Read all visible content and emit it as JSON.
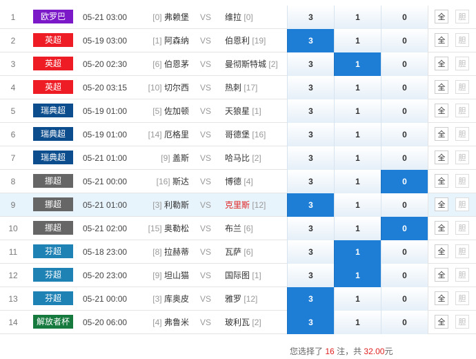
{
  "colors": {
    "selected_odds": "#1e7ed6",
    "highlight_row": "#e8f4fc",
    "red_text": "#e02020"
  },
  "rows": [
    {
      "idx": "1",
      "league": "欧罗巴",
      "league_color": "#7b19c9",
      "time": "05-21 03:00",
      "home_rank": "[0]",
      "home": "弗赖堡",
      "vs": "VS",
      "away": "维拉",
      "away_rank": "[0]",
      "odds": [
        "3",
        "1",
        "0"
      ],
      "selected": [
        false,
        false,
        false
      ],
      "btn_all": "全",
      "btn_ban": "胆"
    },
    {
      "idx": "2",
      "league": "英超",
      "league_color": "#ee1c24",
      "time": "05-19 03:00",
      "home_rank": "[1]",
      "home": "阿森纳",
      "vs": "VS",
      "away": "伯恩利",
      "away_rank": "[19]",
      "odds": [
        "3",
        "1",
        "0"
      ],
      "selected": [
        true,
        false,
        false
      ],
      "btn_all": "全",
      "btn_ban": "胆"
    },
    {
      "idx": "3",
      "league": "英超",
      "league_color": "#ee1c24",
      "time": "05-20 02:30",
      "home_rank": "[6]",
      "home": "伯恩茅",
      "vs": "VS",
      "away": "曼彻斯特城",
      "away_rank": "[2]",
      "odds": [
        "3",
        "1",
        "0"
      ],
      "selected": [
        false,
        true,
        false
      ],
      "btn_all": "全",
      "btn_ban": "胆"
    },
    {
      "idx": "4",
      "league": "英超",
      "league_color": "#ee1c24",
      "time": "05-20 03:15",
      "home_rank": "[10]",
      "home": "切尔西",
      "vs": "VS",
      "away": "热刺",
      "away_rank": "[17]",
      "odds": [
        "3",
        "1",
        "0"
      ],
      "selected": [
        false,
        false,
        false
      ],
      "btn_all": "全",
      "btn_ban": "胆"
    },
    {
      "idx": "5",
      "league": "瑞典超",
      "league_color": "#0c4d8e",
      "time": "05-19 01:00",
      "home_rank": "[5]",
      "home": "佐加顿",
      "vs": "VS",
      "away": "天狼星",
      "away_rank": "[1]",
      "odds": [
        "3",
        "1",
        "0"
      ],
      "selected": [
        false,
        false,
        false
      ],
      "btn_all": "全",
      "btn_ban": "胆"
    },
    {
      "idx": "6",
      "league": "瑞典超",
      "league_color": "#0c4d8e",
      "time": "05-19 01:00",
      "home_rank": "[14]",
      "home": "厄格里",
      "vs": "VS",
      "away": "哥德堡",
      "away_rank": "[16]",
      "odds": [
        "3",
        "1",
        "0"
      ],
      "selected": [
        false,
        false,
        false
      ],
      "btn_all": "全",
      "btn_ban": "胆"
    },
    {
      "idx": "7",
      "league": "瑞典超",
      "league_color": "#0c4d8e",
      "time": "05-21 01:00",
      "home_rank": "[9]",
      "home": "盖斯",
      "vs": "VS",
      "away": "哈马比",
      "away_rank": "[2]",
      "odds": [
        "3",
        "1",
        "0"
      ],
      "selected": [
        false,
        false,
        false
      ],
      "btn_all": "全",
      "btn_ban": "胆"
    },
    {
      "idx": "8",
      "league": "挪超",
      "league_color": "#666666",
      "time": "05-21 00:00",
      "home_rank": "[16]",
      "home": "斯达",
      "vs": "VS",
      "away": "博德",
      "away_rank": "[4]",
      "odds": [
        "3",
        "1",
        "0"
      ],
      "selected": [
        false,
        false,
        true
      ],
      "btn_all": "全",
      "btn_ban": "胆"
    },
    {
      "idx": "9",
      "league": "挪超",
      "league_color": "#666666",
      "time": "05-21 01:00",
      "home_rank": "[3]",
      "home": "利勒斯",
      "vs": "VS",
      "away": "克里斯",
      "away_rank": "[12]",
      "odds": [
        "3",
        "1",
        "0"
      ],
      "selected": [
        true,
        false,
        false
      ],
      "btn_all": "全",
      "btn_ban": "胆",
      "highlight": true,
      "away_red": true
    },
    {
      "idx": "10",
      "league": "挪超",
      "league_color": "#666666",
      "time": "05-21 02:00",
      "home_rank": "[15]",
      "home": "奥勒松",
      "vs": "VS",
      "away": "布兰",
      "away_rank": "[6]",
      "odds": [
        "3",
        "1",
        "0"
      ],
      "selected": [
        false,
        false,
        true
      ],
      "btn_all": "全",
      "btn_ban": "胆"
    },
    {
      "idx": "11",
      "league": "芬超",
      "league_color": "#1f82b5",
      "time": "05-18 23:00",
      "home_rank": "[8]",
      "home": "拉赫蒂",
      "vs": "VS",
      "away": "瓦萨",
      "away_rank": "[6]",
      "odds": [
        "3",
        "1",
        "0"
      ],
      "selected": [
        false,
        true,
        false
      ],
      "btn_all": "全",
      "btn_ban": "胆"
    },
    {
      "idx": "12",
      "league": "芬超",
      "league_color": "#1f82b5",
      "time": "05-20 23:00",
      "home_rank": "[9]",
      "home": "坦山猫",
      "vs": "VS",
      "away": "国际图",
      "away_rank": "[1]",
      "odds": [
        "3",
        "1",
        "0"
      ],
      "selected": [
        false,
        true,
        false
      ],
      "btn_all": "全",
      "btn_ban": "胆"
    },
    {
      "idx": "13",
      "league": "芬超",
      "league_color": "#1f82b5",
      "time": "05-21 00:00",
      "home_rank": "[3]",
      "home": "库奥皮",
      "vs": "VS",
      "away": "雅罗",
      "away_rank": "[12]",
      "odds": [
        "3",
        "1",
        "0"
      ],
      "selected": [
        true,
        false,
        false
      ],
      "btn_all": "全",
      "btn_ban": "胆"
    },
    {
      "idx": "14",
      "league": "解放者杯",
      "league_color": "#167a3e",
      "time": "05-20 06:00",
      "home_rank": "[4]",
      "home": "弗鲁米",
      "vs": "VS",
      "away": "玻利瓦",
      "away_rank": "[2]",
      "odds": [
        "3",
        "1",
        "0"
      ],
      "selected": [
        true,
        false,
        false
      ],
      "btn_all": "全",
      "btn_ban": "胆"
    }
  ],
  "summary": {
    "prefix": "您选择了",
    "count": "16",
    "mid": "注，共",
    "amount": "32.00",
    "suffix": "元"
  }
}
